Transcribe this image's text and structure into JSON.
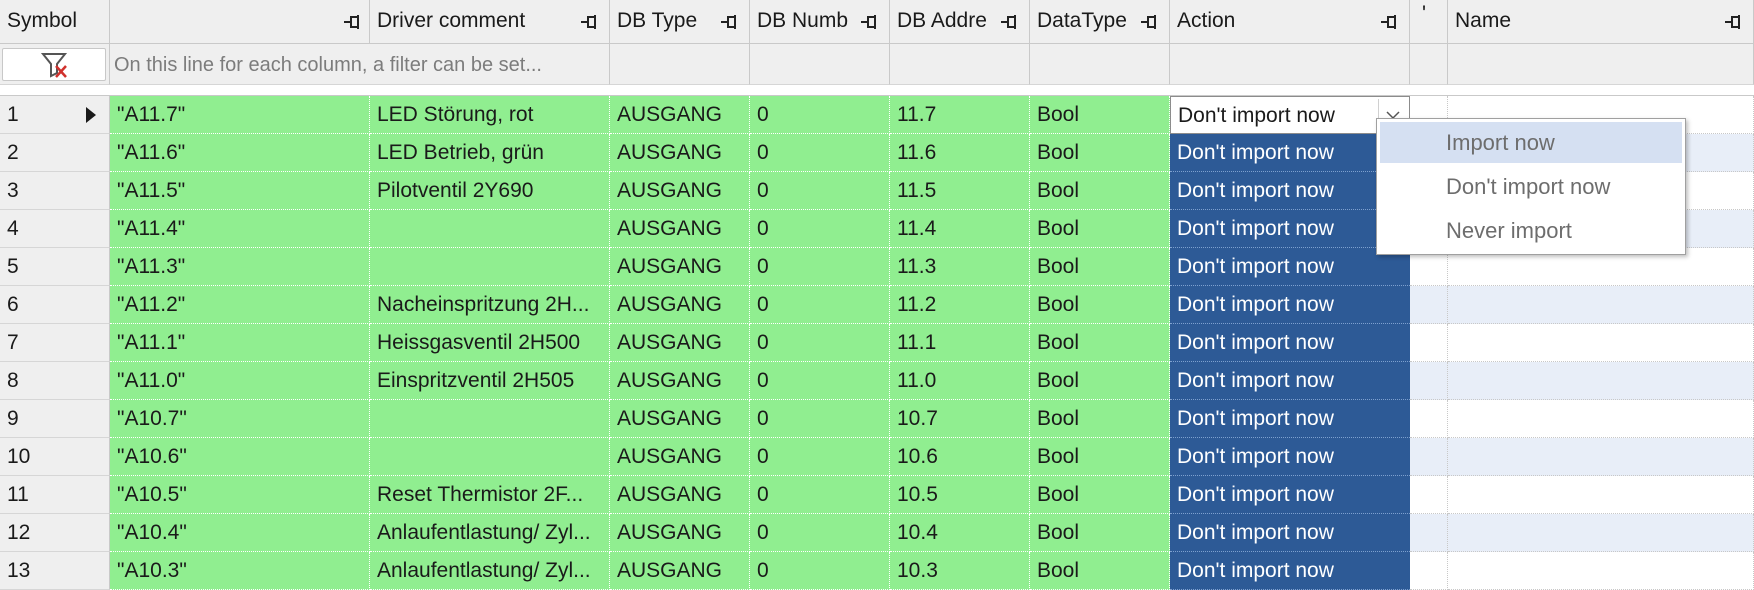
{
  "columns": [
    {
      "label": "Symbol"
    },
    {
      "label": "Driver comment"
    },
    {
      "label": "DB Type"
    },
    {
      "label": "DB Numb"
    },
    {
      "label": "DB Addre"
    },
    {
      "label": "DataType"
    },
    {
      "label": "Action"
    },
    {
      "label": "'"
    },
    {
      "label": "Name"
    }
  ],
  "filter": {
    "placeholder": "On this line for each column, a filter can be set..."
  },
  "rows": [
    {
      "num": "1",
      "symbol": "\"A11.7\"",
      "comment": "LED Störung, rot",
      "dbtype": "AUSGANG",
      "dbnum": "0",
      "dbaddr": "11.7",
      "datatype": "Bool",
      "action": "Don't import now"
    },
    {
      "num": "2",
      "symbol": "\"A11.6\"",
      "comment": "LED Betrieb, grün",
      "dbtype": "AUSGANG",
      "dbnum": "0",
      "dbaddr": "11.6",
      "datatype": "Bool",
      "action": "Don't import now"
    },
    {
      "num": "3",
      "symbol": "\"A11.5\"",
      "comment": "Pilotventil 2Y690",
      "dbtype": "AUSGANG",
      "dbnum": "0",
      "dbaddr": "11.5",
      "datatype": "Bool",
      "action": "Don't import now"
    },
    {
      "num": "4",
      "symbol": "\"A11.4\"",
      "comment": "",
      "dbtype": "AUSGANG",
      "dbnum": "0",
      "dbaddr": "11.4",
      "datatype": "Bool",
      "action": "Don't import now"
    },
    {
      "num": "5",
      "symbol": "\"A11.3\"",
      "comment": "",
      "dbtype": "AUSGANG",
      "dbnum": "0",
      "dbaddr": "11.3",
      "datatype": "Bool",
      "action": "Don't import now"
    },
    {
      "num": "6",
      "symbol": "\"A11.2\"",
      "comment": "Nacheinspritzung 2H...",
      "dbtype": "AUSGANG",
      "dbnum": "0",
      "dbaddr": "11.2",
      "datatype": "Bool",
      "action": "Don't import now"
    },
    {
      "num": "7",
      "symbol": "\"A11.1\"",
      "comment": "Heissgasventil 2H500",
      "dbtype": "AUSGANG",
      "dbnum": "0",
      "dbaddr": "11.1",
      "datatype": "Bool",
      "action": "Don't import now"
    },
    {
      "num": "8",
      "symbol": "\"A11.0\"",
      "comment": "Einspritzventil 2H505",
      "dbtype": "AUSGANG",
      "dbnum": "0",
      "dbaddr": "11.0",
      "datatype": "Bool",
      "action": "Don't import now"
    },
    {
      "num": "9",
      "symbol": "\"A10.7\"",
      "comment": "",
      "dbtype": "AUSGANG",
      "dbnum": "0",
      "dbaddr": "10.7",
      "datatype": "Bool",
      "action": "Don't import now"
    },
    {
      "num": "10",
      "symbol": "\"A10.6\"",
      "comment": "",
      "dbtype": "AUSGANG",
      "dbnum": "0",
      "dbaddr": "10.6",
      "datatype": "Bool",
      "action": "Don't import now"
    },
    {
      "num": "11",
      "symbol": "\"A10.5\"",
      "comment": "Reset Thermistor 2F...",
      "dbtype": "AUSGANG",
      "dbnum": "0",
      "dbaddr": "10.5",
      "datatype": "Bool",
      "action": "Don't import now"
    },
    {
      "num": "12",
      "symbol": "\"A10.4\"",
      "comment": "Anlaufentlastung/ Zyl...",
      "dbtype": "AUSGANG",
      "dbnum": "0",
      "dbaddr": "10.4",
      "datatype": "Bool",
      "action": "Don't import now"
    },
    {
      "num": "13",
      "symbol": "\"A10.3\"",
      "comment": "Anlaufentlastung/ Zyl...",
      "dbtype": "AUSGANG",
      "dbnum": "0",
      "dbaddr": "10.3",
      "datatype": "Bool",
      "action": "Don't import now"
    }
  ],
  "dropdown": {
    "options": [
      {
        "label": "Import now"
      },
      {
        "label": "Don't import now"
      },
      {
        "label": "Never import"
      }
    ]
  },
  "colors": {
    "matched_row": "#90ee90",
    "action_selected": "#2d5a96",
    "alt_row": "#e8eef8",
    "highlight": "#d5e0f2"
  }
}
